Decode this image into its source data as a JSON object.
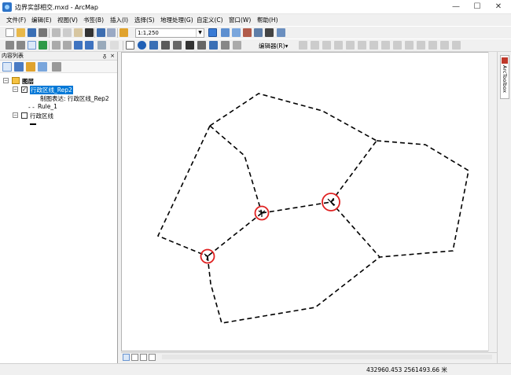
{
  "window": {
    "title": "边界实部相交.mxd - ArcMap",
    "minimize": "—",
    "maximize": "☐",
    "close": "✕"
  },
  "menu": {
    "items": [
      "文件(F)",
      "编辑(E)",
      "视图(V)",
      "书签(B)",
      "插入(I)",
      "选择(S)",
      "地理处理(G)",
      "自定义(C)",
      "窗口(W)",
      "帮助(H)"
    ]
  },
  "toolbar": {
    "scale_value": "1:1,250",
    "editor_label": "编辑器(R)▾"
  },
  "toc": {
    "title": "内容列表",
    "pin": "ᵹ",
    "close": "×",
    "layers_label": "图层",
    "layer1": {
      "name": "行政区线_Rep2",
      "checked": true,
      "representation": "制图表达: 行政区线_Rep2",
      "rule": "Rule_1"
    },
    "layer2": {
      "name": "行政区线",
      "checked": false
    }
  },
  "right_panel": {
    "tab_label": "ArcToolbox"
  },
  "status": {
    "coordinates": "432960.453   2561493.66 米"
  },
  "colors": {
    "selection": "#0078d7",
    "highlight_circle": "#e02020",
    "line": "#000000"
  }
}
